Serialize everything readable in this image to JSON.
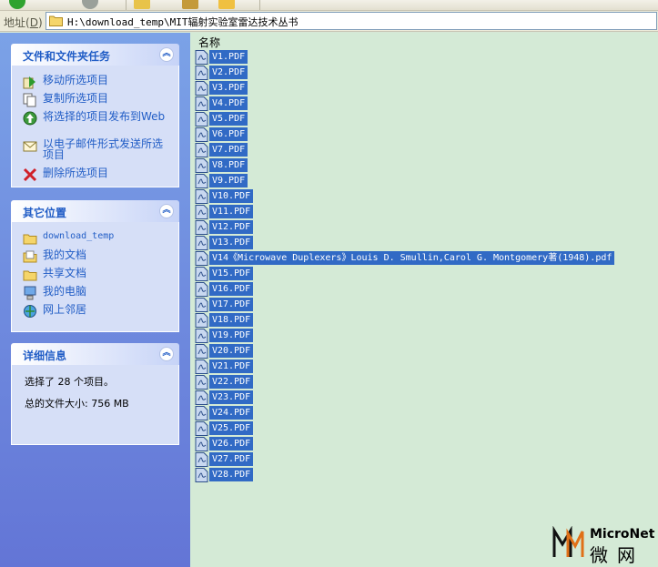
{
  "address": {
    "label": "地址",
    "accel": "D",
    "path": "H:\\download_temp\\MIT辐射实验室雷达技术丛书"
  },
  "tasks_panel": {
    "title": "文件和文件夹任务",
    "items": [
      {
        "label": "移动所选项目",
        "icon": "move-icon"
      },
      {
        "label": "复制所选项目",
        "icon": "copy-icon"
      },
      {
        "label": "将选择的项目发布到Web",
        "icon": "publish-web-icon"
      },
      {
        "label": "以电子邮件形式发送所选项目",
        "icon": "email-icon"
      },
      {
        "label": "删除所选项目",
        "icon": "delete-icon"
      }
    ]
  },
  "places_panel": {
    "title": "其它位置",
    "items": [
      {
        "label": "download_temp",
        "icon": "folder-icon"
      },
      {
        "label": "我的文档",
        "icon": "my-documents-icon"
      },
      {
        "label": "共享文档",
        "icon": "shared-documents-icon"
      },
      {
        "label": "我的电脑",
        "icon": "my-computer-icon"
      },
      {
        "label": "网上邻居",
        "icon": "network-places-icon"
      }
    ]
  },
  "details_panel": {
    "title": "详细信息",
    "selected": "选择了 28 个项目。",
    "total_size": "总的文件大小: 756 MB"
  },
  "file_list": {
    "column_name": "名称",
    "files": [
      "V1.PDF",
      "V2.PDF",
      "V3.PDF",
      "V4.PDF",
      "V5.PDF",
      "V6.PDF",
      "V7.PDF",
      "V8.PDF",
      "V9.PDF",
      "V10.PDF",
      "V11.PDF",
      "V12.PDF",
      "V13.PDF",
      "V14《Microwave Duplexers》Louis D. Smullin,Carol G. Montgomery著(1948).pdf",
      "V15.PDF",
      "V16.PDF",
      "V17.PDF",
      "V18.PDF",
      "V19.PDF",
      "V20.PDF",
      "V21.PDF",
      "V22.PDF",
      "V23.PDF",
      "V24.PDF",
      "V25.PDF",
      "V26.PDF",
      "V27.PDF",
      "V28.PDF"
    ]
  },
  "watermark": {
    "brand": "MicroNet",
    "brand_cn": "微网"
  },
  "colors": {
    "selection": "#316ac5",
    "pane_link": "#215dc6",
    "list_background": "#d4ead6"
  }
}
